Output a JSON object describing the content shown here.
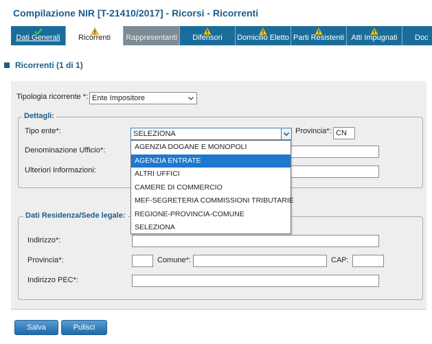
{
  "header": {
    "title": "Compilazione NIR [T-21410/2017] - Ricorsi - Ricorrenti"
  },
  "tabs": [
    {
      "label": "Dati Generali",
      "icon": "check-icon"
    },
    {
      "label": "Ricorrenti",
      "icon": "warning-icon"
    },
    {
      "label": "Rappresentanti",
      "icon": ""
    },
    {
      "label": "Difensori",
      "icon": "warning-icon"
    },
    {
      "label": "Domicilio Eletto",
      "icon": "warning-icon"
    },
    {
      "label": "Parti Resistenti",
      "icon": "warning-icon"
    },
    {
      "label": "Atti Impugnati",
      "icon": "warning-icon"
    },
    {
      "label": "Doc",
      "icon": ""
    }
  ],
  "section": {
    "title": "Ricorrenti (1 di 1)"
  },
  "form": {
    "tipologia_label": "Tipologia ricorrente *:",
    "tipologia_value": "Ente Impositore",
    "dettagli": {
      "legend": "Dettagli:",
      "tipo_ente_label": "Tipo ente*:",
      "tipo_ente_value": "SELEZIONA",
      "provincia_label": "Provincia*:",
      "provincia_value": "CN",
      "denominazione_label": "Denominazione Ufficio*:",
      "ulteriori_label": "Ulteriori Informazioni:"
    },
    "dropdown_options": [
      "AGENZIA DOGANE E MONOPOLI",
      "AGENZIA ENTRATE",
      "ALTRI UFFICI",
      "CAMERE DI COMMERCIO",
      "MEF-SEGRETERIA COMMISSIONI TRIBUTARIE",
      "REGIONE-PROVINCIA-COMUNE",
      "SELEZIONA"
    ],
    "residenza": {
      "legend": "Dati Residenza/Sede legale:",
      "indirizzo_label": "Indirizzo*:",
      "provincia_label": "Provincia*:",
      "comune_label": "Comune*:",
      "cap_label": "CAP:",
      "pec_label": "Indirizzo PEC*:"
    }
  },
  "buttons": {
    "save": "Salva",
    "clear": "Pulisci"
  },
  "colors": {
    "title": "#1b5c8a",
    "tabbar": "#1a6d9a",
    "highlight": "#1e78d0",
    "warning": "#f5c518",
    "check": "#2e9e3a"
  }
}
